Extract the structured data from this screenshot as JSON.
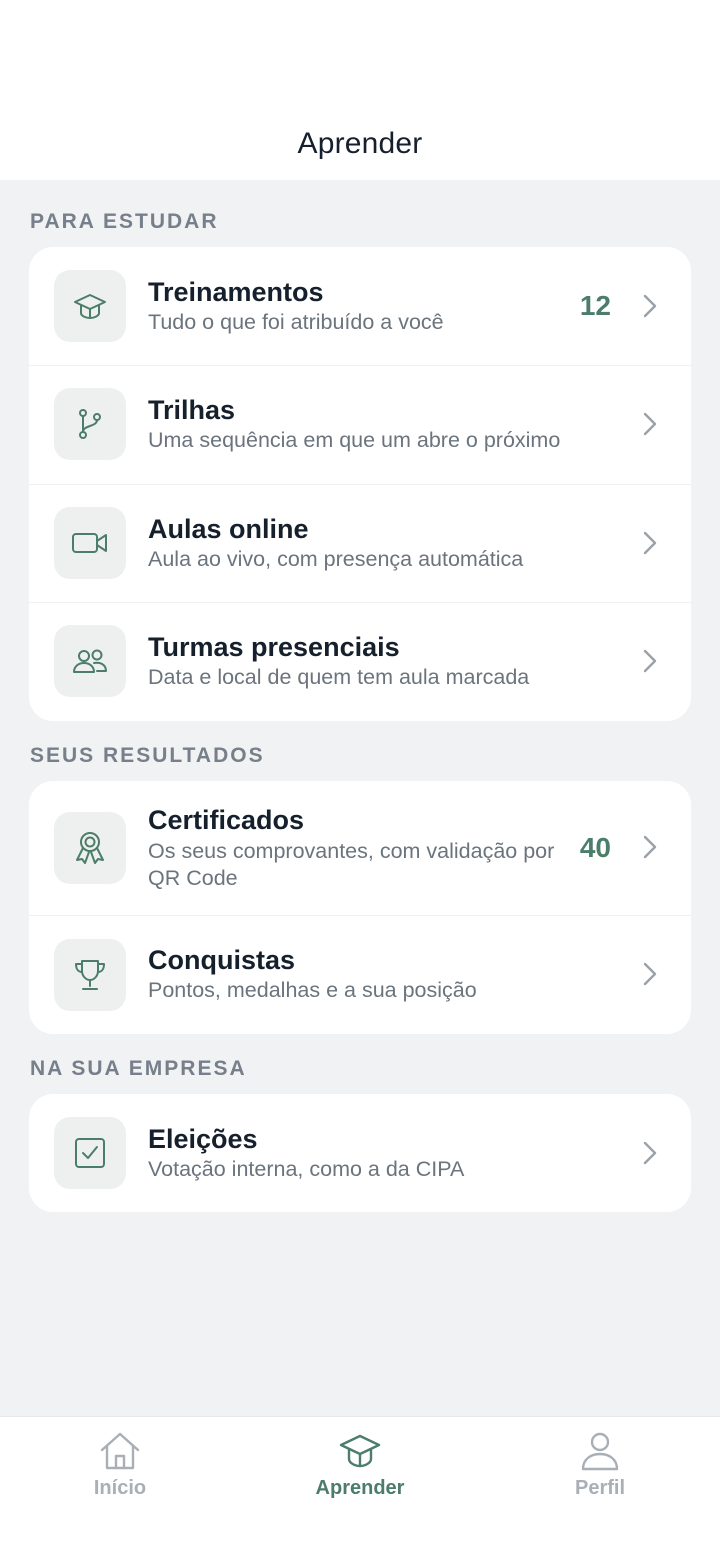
{
  "header": {
    "title": "Aprender"
  },
  "sections": [
    {
      "label": "PARA ESTUDAR",
      "items": [
        {
          "title": "Treinamentos",
          "subtitle": "Tudo o que foi atribuído a você",
          "count": "12",
          "icon": "graduation-cap-icon"
        },
        {
          "title": "Trilhas",
          "subtitle": "Uma sequência em que um abre o próximo",
          "count": "",
          "icon": "git-branch-icon"
        },
        {
          "title": "Aulas online",
          "subtitle": "Aula ao vivo, com presença automática",
          "count": "",
          "icon": "video-camera-icon"
        },
        {
          "title": "Turmas presenciais",
          "subtitle": "Data e local de quem tem aula marcada",
          "count": "",
          "icon": "users-icon"
        }
      ]
    },
    {
      "label": "SEUS RESULTADOS",
      "items": [
        {
          "title": "Certificados",
          "subtitle": "Os seus comprovantes, com validação por QR Code",
          "count": "40",
          "icon": "award-ribbon-icon"
        },
        {
          "title": "Conquistas",
          "subtitle": "Pontos, medalhas e a sua posição",
          "count": "",
          "icon": "trophy-icon"
        }
      ]
    },
    {
      "label": "NA SUA EMPRESA",
      "items": [
        {
          "title": "Eleições",
          "subtitle": "Votação interna, como a da CIPA",
          "count": "",
          "icon": "checkbox-icon"
        }
      ]
    }
  ],
  "tabbar": {
    "tabs": [
      {
        "label": "Início",
        "icon": "home-icon",
        "active": false
      },
      {
        "label": "Aprender",
        "icon": "graduation-cap-icon",
        "active": true
      },
      {
        "label": "Perfil",
        "icon": "user-icon",
        "active": false
      }
    ]
  },
  "colors": {
    "accent": "#4b7d6a",
    "background": "#f1f2f4",
    "inactive": "#a8afb6"
  }
}
